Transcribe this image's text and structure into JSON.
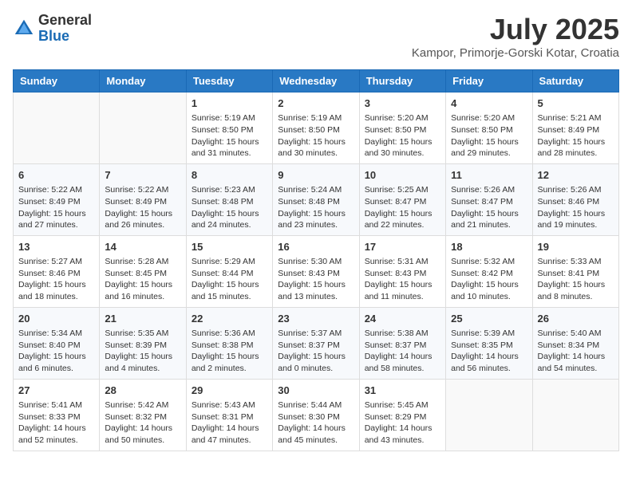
{
  "header": {
    "logo_general": "General",
    "logo_blue": "Blue",
    "month_title": "July 2025",
    "subtitle": "Kampor, Primorje-Gorski Kotar, Croatia"
  },
  "weekdays": [
    "Sunday",
    "Monday",
    "Tuesday",
    "Wednesday",
    "Thursday",
    "Friday",
    "Saturday"
  ],
  "weeks": [
    [
      {
        "day": "",
        "sunrise": "",
        "sunset": "",
        "daylight": ""
      },
      {
        "day": "",
        "sunrise": "",
        "sunset": "",
        "daylight": ""
      },
      {
        "day": "1",
        "sunrise": "Sunrise: 5:19 AM",
        "sunset": "Sunset: 8:50 PM",
        "daylight": "Daylight: 15 hours and 31 minutes."
      },
      {
        "day": "2",
        "sunrise": "Sunrise: 5:19 AM",
        "sunset": "Sunset: 8:50 PM",
        "daylight": "Daylight: 15 hours and 30 minutes."
      },
      {
        "day": "3",
        "sunrise": "Sunrise: 5:20 AM",
        "sunset": "Sunset: 8:50 PM",
        "daylight": "Daylight: 15 hours and 30 minutes."
      },
      {
        "day": "4",
        "sunrise": "Sunrise: 5:20 AM",
        "sunset": "Sunset: 8:50 PM",
        "daylight": "Daylight: 15 hours and 29 minutes."
      },
      {
        "day": "5",
        "sunrise": "Sunrise: 5:21 AM",
        "sunset": "Sunset: 8:49 PM",
        "daylight": "Daylight: 15 hours and 28 minutes."
      }
    ],
    [
      {
        "day": "6",
        "sunrise": "Sunrise: 5:22 AM",
        "sunset": "Sunset: 8:49 PM",
        "daylight": "Daylight: 15 hours and 27 minutes."
      },
      {
        "day": "7",
        "sunrise": "Sunrise: 5:22 AM",
        "sunset": "Sunset: 8:49 PM",
        "daylight": "Daylight: 15 hours and 26 minutes."
      },
      {
        "day": "8",
        "sunrise": "Sunrise: 5:23 AM",
        "sunset": "Sunset: 8:48 PM",
        "daylight": "Daylight: 15 hours and 24 minutes."
      },
      {
        "day": "9",
        "sunrise": "Sunrise: 5:24 AM",
        "sunset": "Sunset: 8:48 PM",
        "daylight": "Daylight: 15 hours and 23 minutes."
      },
      {
        "day": "10",
        "sunrise": "Sunrise: 5:25 AM",
        "sunset": "Sunset: 8:47 PM",
        "daylight": "Daylight: 15 hours and 22 minutes."
      },
      {
        "day": "11",
        "sunrise": "Sunrise: 5:26 AM",
        "sunset": "Sunset: 8:47 PM",
        "daylight": "Daylight: 15 hours and 21 minutes."
      },
      {
        "day": "12",
        "sunrise": "Sunrise: 5:26 AM",
        "sunset": "Sunset: 8:46 PM",
        "daylight": "Daylight: 15 hours and 19 minutes."
      }
    ],
    [
      {
        "day": "13",
        "sunrise": "Sunrise: 5:27 AM",
        "sunset": "Sunset: 8:46 PM",
        "daylight": "Daylight: 15 hours and 18 minutes."
      },
      {
        "day": "14",
        "sunrise": "Sunrise: 5:28 AM",
        "sunset": "Sunset: 8:45 PM",
        "daylight": "Daylight: 15 hours and 16 minutes."
      },
      {
        "day": "15",
        "sunrise": "Sunrise: 5:29 AM",
        "sunset": "Sunset: 8:44 PM",
        "daylight": "Daylight: 15 hours and 15 minutes."
      },
      {
        "day": "16",
        "sunrise": "Sunrise: 5:30 AM",
        "sunset": "Sunset: 8:43 PM",
        "daylight": "Daylight: 15 hours and 13 minutes."
      },
      {
        "day": "17",
        "sunrise": "Sunrise: 5:31 AM",
        "sunset": "Sunset: 8:43 PM",
        "daylight": "Daylight: 15 hours and 11 minutes."
      },
      {
        "day": "18",
        "sunrise": "Sunrise: 5:32 AM",
        "sunset": "Sunset: 8:42 PM",
        "daylight": "Daylight: 15 hours and 10 minutes."
      },
      {
        "day": "19",
        "sunrise": "Sunrise: 5:33 AM",
        "sunset": "Sunset: 8:41 PM",
        "daylight": "Daylight: 15 hours and 8 minutes."
      }
    ],
    [
      {
        "day": "20",
        "sunrise": "Sunrise: 5:34 AM",
        "sunset": "Sunset: 8:40 PM",
        "daylight": "Daylight: 15 hours and 6 minutes."
      },
      {
        "day": "21",
        "sunrise": "Sunrise: 5:35 AM",
        "sunset": "Sunset: 8:39 PM",
        "daylight": "Daylight: 15 hours and 4 minutes."
      },
      {
        "day": "22",
        "sunrise": "Sunrise: 5:36 AM",
        "sunset": "Sunset: 8:38 PM",
        "daylight": "Daylight: 15 hours and 2 minutes."
      },
      {
        "day": "23",
        "sunrise": "Sunrise: 5:37 AM",
        "sunset": "Sunset: 8:37 PM",
        "daylight": "Daylight: 15 hours and 0 minutes."
      },
      {
        "day": "24",
        "sunrise": "Sunrise: 5:38 AM",
        "sunset": "Sunset: 8:37 PM",
        "daylight": "Daylight: 14 hours and 58 minutes."
      },
      {
        "day": "25",
        "sunrise": "Sunrise: 5:39 AM",
        "sunset": "Sunset: 8:35 PM",
        "daylight": "Daylight: 14 hours and 56 minutes."
      },
      {
        "day": "26",
        "sunrise": "Sunrise: 5:40 AM",
        "sunset": "Sunset: 8:34 PM",
        "daylight": "Daylight: 14 hours and 54 minutes."
      }
    ],
    [
      {
        "day": "27",
        "sunrise": "Sunrise: 5:41 AM",
        "sunset": "Sunset: 8:33 PM",
        "daylight": "Daylight: 14 hours and 52 minutes."
      },
      {
        "day": "28",
        "sunrise": "Sunrise: 5:42 AM",
        "sunset": "Sunset: 8:32 PM",
        "daylight": "Daylight: 14 hours and 50 minutes."
      },
      {
        "day": "29",
        "sunrise": "Sunrise: 5:43 AM",
        "sunset": "Sunset: 8:31 PM",
        "daylight": "Daylight: 14 hours and 47 minutes."
      },
      {
        "day": "30",
        "sunrise": "Sunrise: 5:44 AM",
        "sunset": "Sunset: 8:30 PM",
        "daylight": "Daylight: 14 hours and 45 minutes."
      },
      {
        "day": "31",
        "sunrise": "Sunrise: 5:45 AM",
        "sunset": "Sunset: 8:29 PM",
        "daylight": "Daylight: 14 hours and 43 minutes."
      },
      {
        "day": "",
        "sunrise": "",
        "sunset": "",
        "daylight": ""
      },
      {
        "day": "",
        "sunrise": "",
        "sunset": "",
        "daylight": ""
      }
    ]
  ]
}
